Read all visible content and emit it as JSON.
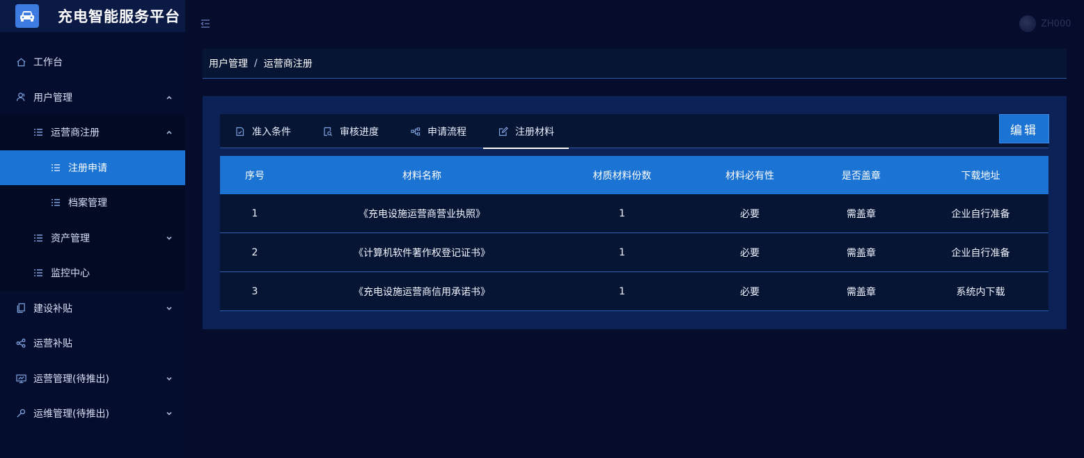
{
  "app": {
    "title": "充电智能服务平台",
    "logo_icon": "car-icon"
  },
  "header": {
    "user_name": "ZH000"
  },
  "sidebar": {
    "items": [
      {
        "label": "工作台",
        "icon": "home-icon"
      },
      {
        "label": "用户管理",
        "icon": "user-icon",
        "expanded": true
      },
      {
        "label": "运营商注册",
        "icon": "list-icon",
        "expanded": true
      },
      {
        "label": "注册申请",
        "icon": "list-icon",
        "active": true
      },
      {
        "label": "档案管理",
        "icon": "list-icon"
      },
      {
        "label": "资产管理",
        "icon": "list-icon"
      },
      {
        "label": "监控中心",
        "icon": "list-icon"
      },
      {
        "label": "建设补贴",
        "icon": "document-icon"
      },
      {
        "label": "运营补贴",
        "icon": "share-icon"
      },
      {
        "label": "运营管理(待推出)",
        "icon": "monitor-icon"
      },
      {
        "label": "运维管理(待推出)",
        "icon": "wrench-icon"
      }
    ]
  },
  "breadcrumb": {
    "parent": "用户管理",
    "separator": "/",
    "current": "运营商注册"
  },
  "tabs": [
    {
      "label": "准入条件",
      "icon": "document-check-icon"
    },
    {
      "label": "审核进度",
      "icon": "search-document-icon"
    },
    {
      "label": "申请流程",
      "icon": "flow-icon"
    },
    {
      "label": "注册材料",
      "icon": "edit-icon",
      "active": true
    }
  ],
  "toolbar": {
    "edit_label": "编辑"
  },
  "table": {
    "headers": [
      "序号",
      "材料名称",
      "材质材料份数",
      "材料必有性",
      "是否盖章",
      "下载地址"
    ],
    "rows": [
      [
        "1",
        "《充电设施运营商营业执照》",
        "1",
        "必要",
        "需盖章",
        "企业自行准备"
      ],
      [
        "2",
        "《计算机软件著作权登记证书》",
        "1",
        "必要",
        "需盖章",
        "企业自行准备"
      ],
      [
        "3",
        "《充电设施运营商信用承诺书》",
        "1",
        "必要",
        "需盖章",
        "系统内下载"
      ]
    ]
  },
  "colors": {
    "accent": "#1b73d3",
    "background": "#050c2c",
    "panel": "#0c2256"
  }
}
